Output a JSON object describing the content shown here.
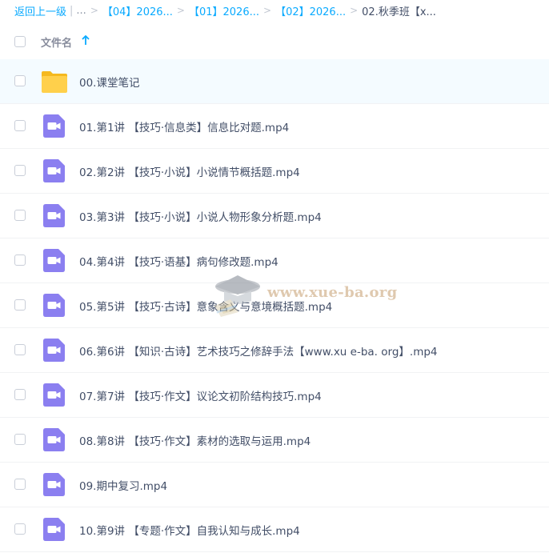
{
  "breadcrumb": {
    "back_label": "返回上一级",
    "ellipsis": "...",
    "items": [
      "【04】2026...",
      "【01】2026...",
      "【02】2026..."
    ],
    "current": "02.秋季班【x..."
  },
  "header": {
    "column_label": "文件名",
    "sort_direction": "ascending"
  },
  "files": [
    {
      "name": "00.课堂笔记",
      "type": "folder",
      "selected": true
    },
    {
      "name": "01.第1讲 【技巧·信息类】信息比对题.mp4",
      "type": "video"
    },
    {
      "name": "02.第2讲 【技巧·小说】小说情节概括题.mp4",
      "type": "video"
    },
    {
      "name": "03.第3讲 【技巧·小说】小说人物形象分析题.mp4",
      "type": "video"
    },
    {
      "name": "04.第4讲 【技巧·语基】病句修改题.mp4",
      "type": "video"
    },
    {
      "name": "05.第5讲 【技巧·古诗】意象含义与意境概括题.mp4",
      "type": "video"
    },
    {
      "name": "06.第6讲 【知识·古诗】艺术技巧之修辞手法【www.xu e-ba. org】.mp4",
      "type": "video"
    },
    {
      "name": "07.第7讲 【技巧·作文】议论文初阶结构技巧.mp4",
      "type": "video"
    },
    {
      "name": "08.第8讲 【技巧·作文】素材的选取与运用.mp4",
      "type": "video"
    },
    {
      "name": "09.期中复习.mp4",
      "type": "video"
    },
    {
      "name": "10.第9讲 【专题·作文】自我认知与成长.mp4",
      "type": "video"
    }
  ],
  "watermark": {
    "text": "www.xue-ba.org"
  },
  "colors": {
    "link": "#09aaff",
    "text": "#424e67",
    "folder": "#ffd04b",
    "video_icon": "#8b7ff0",
    "selected_row": "#f4fbff"
  },
  "icons": {
    "folder": "folder-icon",
    "video": "video-file-icon",
    "sort": "sort-up-arrow-icon"
  }
}
